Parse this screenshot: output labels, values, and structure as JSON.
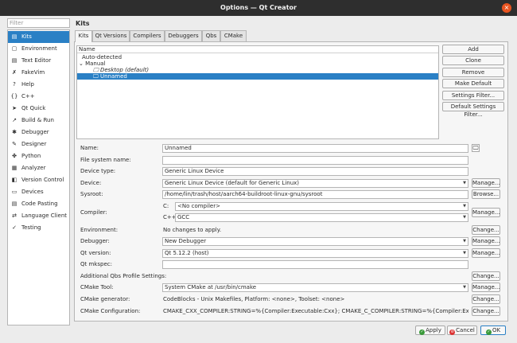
{
  "window": {
    "title": "Options — Qt Creator",
    "close_glyph": "×"
  },
  "sidebar": {
    "filter_placeholder": "Filter",
    "items": [
      {
        "label": "Kits",
        "icon": "kits-icon",
        "glyph": "▤"
      },
      {
        "label": "Environment",
        "icon": "environment-icon",
        "glyph": "▢"
      },
      {
        "label": "Text Editor",
        "icon": "text-editor-icon",
        "glyph": "▤"
      },
      {
        "label": "FakeVim",
        "icon": "fakevim-icon",
        "glyph": "✗"
      },
      {
        "label": "Help",
        "icon": "help-icon",
        "glyph": "?"
      },
      {
        "label": "C++",
        "icon": "cpp-icon",
        "glyph": "{}"
      },
      {
        "label": "Qt Quick",
        "icon": "qtquick-icon",
        "glyph": "➤"
      },
      {
        "label": "Build & Run",
        "icon": "build-run-icon",
        "glyph": "↗"
      },
      {
        "label": "Debugger",
        "icon": "debugger-icon",
        "glyph": "✱"
      },
      {
        "label": "Designer",
        "icon": "designer-icon",
        "glyph": "✎"
      },
      {
        "label": "Python",
        "icon": "python-icon",
        "glyph": "✤"
      },
      {
        "label": "Analyzer",
        "icon": "analyzer-icon",
        "glyph": "▦"
      },
      {
        "label": "Version Control",
        "icon": "version-control-icon",
        "glyph": "◧"
      },
      {
        "label": "Devices",
        "icon": "devices-icon",
        "glyph": "▭"
      },
      {
        "label": "Code Pasting",
        "icon": "code-pasting-icon",
        "glyph": "▤"
      },
      {
        "label": "Language Client",
        "icon": "language-client-icon",
        "glyph": "⇄"
      },
      {
        "label": "Testing",
        "icon": "testing-icon",
        "glyph": "✓"
      }
    ]
  },
  "page": {
    "heading": "Kits",
    "tabs": [
      "Kits",
      "Qt Versions",
      "Compilers",
      "Debuggers",
      "Qbs",
      "CMake"
    ],
    "tree": {
      "header": "Name",
      "rows": [
        {
          "text": "Auto-detected"
        },
        {
          "text": "⌄ Manual"
        },
        {
          "text": "🖵 Desktop (default)"
        },
        {
          "text": "🖵 Unnamed"
        }
      ]
    },
    "right_buttons": [
      "Add",
      "Clone",
      "Remove",
      "Make Default",
      "Settings Filter...",
      "Default Settings Filter..."
    ]
  },
  "form": {
    "name": {
      "label": "Name:",
      "value": "Unnamed"
    },
    "fs_name": {
      "label": "File system name:",
      "value": ""
    },
    "device_type": {
      "label": "Device type:",
      "value": "Generic Linux Device"
    },
    "device": {
      "label": "Device:",
      "value": "Generic Linux Device (default for Generic Linux)",
      "button": "Manage..."
    },
    "sysroot": {
      "label": "Sysroot:",
      "value": "/home/lin/trash/host/aarch64-buildroot-linux-gnu/sysroot",
      "button": "Browse..."
    },
    "compiler": {
      "label": "Compiler:",
      "c_label": "C:",
      "c_value": "<No compiler>",
      "cxx_label": "C++:",
      "cxx_value": "GCC",
      "button": "Manage..."
    },
    "environment": {
      "label": "Environment:",
      "value": "No changes to apply.",
      "button": "Change..."
    },
    "debugger": {
      "label": "Debugger:",
      "value": "New Debugger",
      "button": "Manage..."
    },
    "qt_version": {
      "label": "Qt version:",
      "value": "Qt 5.12.2 (host)",
      "button": "Manage..."
    },
    "qt_mkspec": {
      "label": "Qt mkspec:",
      "value": ""
    },
    "qbs_profile": {
      "label": "Additional Qbs Profile Settings:",
      "button": "Change..."
    },
    "cmake_tool": {
      "label": "CMake Tool:",
      "value": "System CMake at /usr/bin/cmake",
      "button": "Manage..."
    },
    "cmake_generator": {
      "label": "CMake generator:",
      "value": "CodeBlocks - Unix Makefiles, Platform: <none>, Toolset: <none>",
      "button": "Change..."
    },
    "cmake_config": {
      "label": "CMake Configuration:",
      "value": "CMAKE_CXX_COMPILER:STRING=%{Compiler:Executable:Cxx}; CMAKE_C_COMPILER:STRING=%{Compiler:Executable:...",
      "button": "Change..."
    }
  },
  "footer": {
    "apply": "Apply",
    "cancel": "Cancel",
    "ok": "OK"
  },
  "colors": {
    "accent": "#2a80c5",
    "titlebar": "#2e2e2e",
    "close": "#e95420"
  }
}
